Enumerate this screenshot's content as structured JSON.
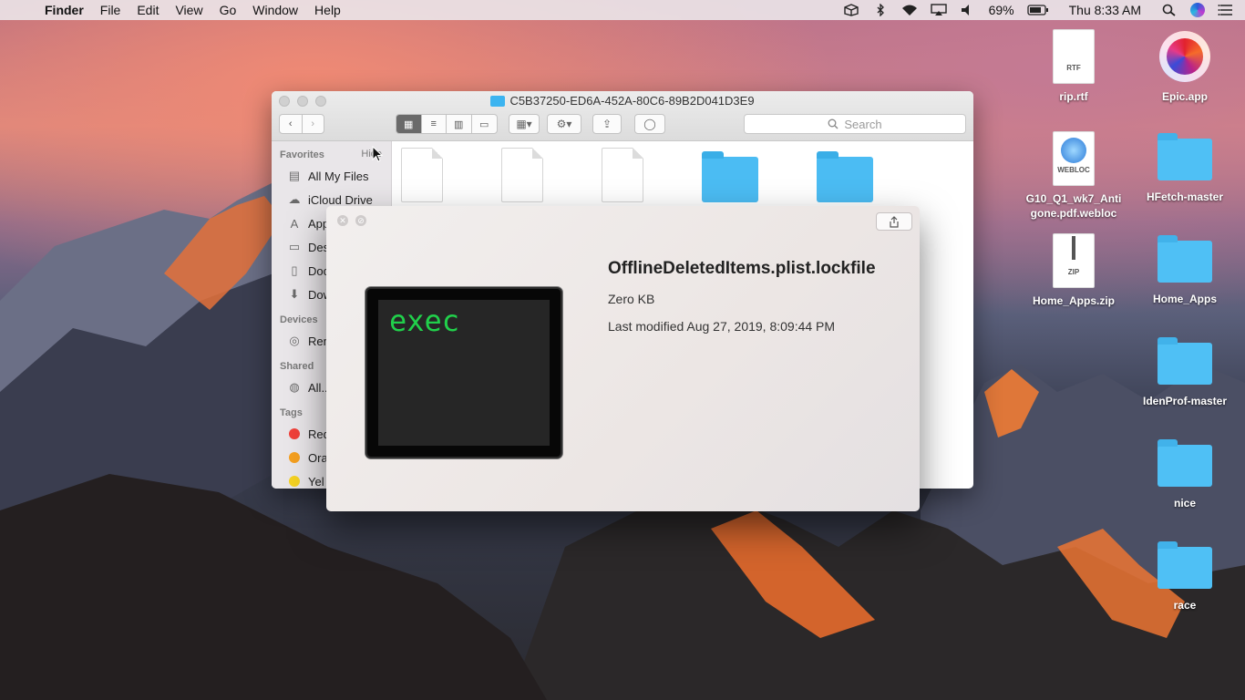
{
  "menubar": {
    "app_name": "Finder",
    "menus": [
      "File",
      "Edit",
      "View",
      "Go",
      "Window",
      "Help"
    ],
    "battery": "69%",
    "clock": "Thu 8:33 AM"
  },
  "finder": {
    "title": "C5B37250-ED6A-452A-80C6-89B2D041D3E9",
    "search_placeholder": "Search",
    "sidebar": {
      "favorites_header": "Favorites",
      "hide_label": "Hide",
      "favorites": [
        "All My Files",
        "iCloud Drive",
        "App",
        "Des",
        "Doc",
        "Dow"
      ],
      "devices_header": "Devices",
      "devices": [
        "Rem"
      ],
      "shared_header": "Shared",
      "shared": [
        "All..."
      ],
      "tags_header": "Tags",
      "tags": [
        {
          "label": "Red",
          "color": "#f0413a"
        },
        {
          "label": "Ora",
          "color": "#f5a020"
        },
        {
          "label": "Yel",
          "color": "#f5d222"
        }
      ]
    }
  },
  "quicklook": {
    "filename": "OfflineDeletedItems.plist.lockfile",
    "size": "Zero KB",
    "modified": "Last modified Aug 27, 2019, 8:09:44 PM",
    "preview_text": "exec"
  },
  "desktop": {
    "icons": [
      {
        "label": "rip.rtf",
        "type": "file",
        "tag": "RTF"
      },
      {
        "label": "Epic.app",
        "type": "app"
      },
      {
        "label": "G10_Q1_wk7_Antigone.pdf.webloc",
        "type": "webloc",
        "tag": "WEBLOC"
      },
      {
        "label": "HFetch-master",
        "type": "folder"
      },
      {
        "label": "Home_Apps.zip",
        "type": "zip",
        "tag": "ZIP"
      },
      {
        "label": "Home_Apps",
        "type": "folder"
      },
      {
        "label": "IdenProf-master",
        "type": "folder"
      },
      {
        "label": "nice",
        "type": "folder"
      },
      {
        "label": "race",
        "type": "folder"
      }
    ]
  }
}
